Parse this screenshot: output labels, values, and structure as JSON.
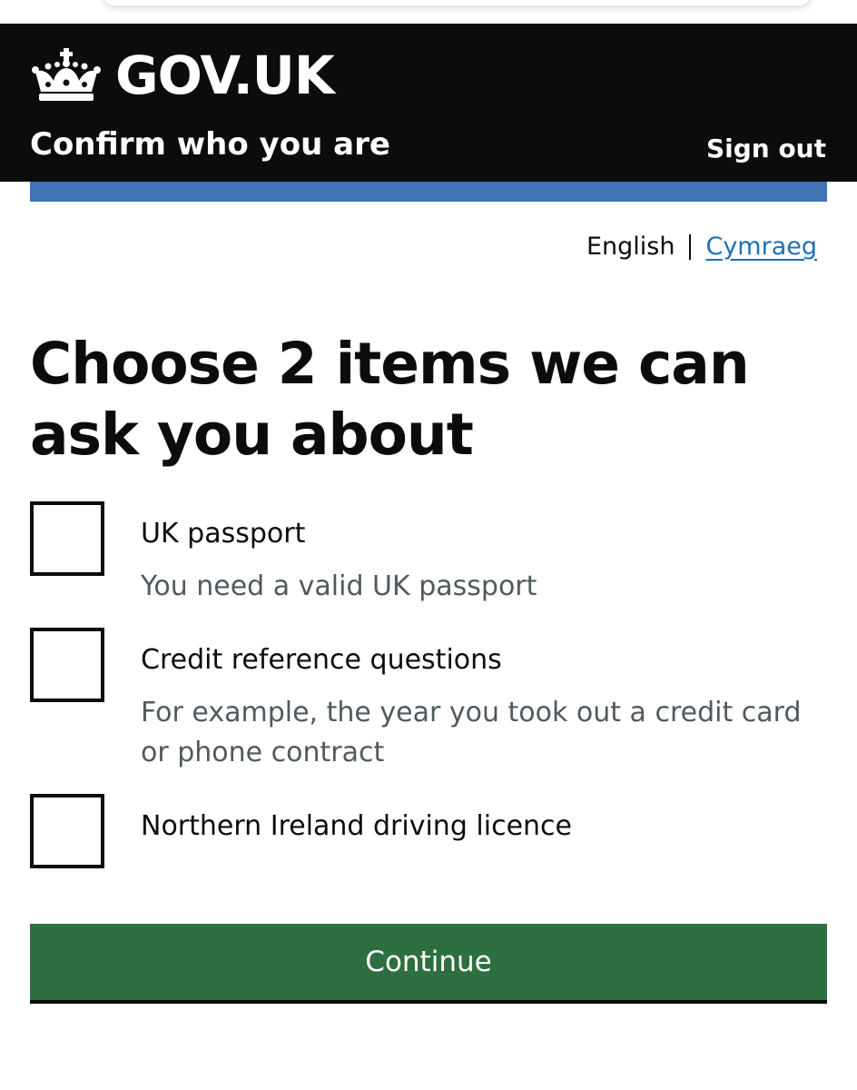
{
  "header": {
    "logo_text": "GOV.UK",
    "service_name": "Confirm who you are",
    "sign_out_label": "Sign out"
  },
  "language": {
    "current": "English",
    "alternate": "Cymraeg"
  },
  "page": {
    "heading": "Choose 2 items we can ask you about"
  },
  "options": [
    {
      "label": "UK passport",
      "hint": "You need a valid UK passport",
      "checked": false
    },
    {
      "label": "Credit reference questions",
      "hint": "For example, the year you took out a credit card or phone contract",
      "checked": false
    },
    {
      "label": "Northern Ireland driving licence",
      "hint": "",
      "checked": false
    }
  ],
  "actions": {
    "continue_label": "Continue"
  },
  "colors": {
    "header_bg": "#0b0c0c",
    "accent_blue": "#3f73b5",
    "link": "#1d70b8",
    "button_green": "#2e6f40",
    "hint_text": "#505a5f"
  }
}
